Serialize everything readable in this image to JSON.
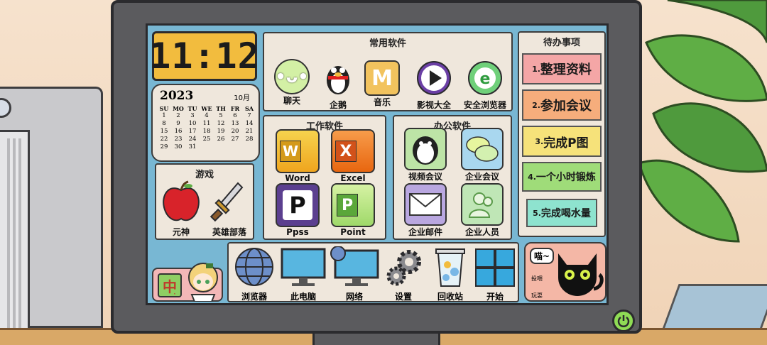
{
  "clock": {
    "time": "11:12"
  },
  "calendar": {
    "year": "2023",
    "month": "10月",
    "weekdays": [
      "SU",
      "MO",
      "TU",
      "WE",
      "TH",
      "FR",
      "SA"
    ],
    "weeks": [
      [
        "1",
        "2",
        "3",
        "4",
        "5",
        "6",
        "7"
      ],
      [
        "8",
        "9",
        "10",
        "11",
        "12",
        "13",
        "14"
      ],
      [
        "15",
        "16",
        "17",
        "18",
        "19",
        "20",
        "21"
      ],
      [
        "22",
        "23",
        "24",
        "25",
        "26",
        "27",
        "28"
      ],
      [
        "29",
        "30",
        "31",
        "",
        "",
        "",
        ""
      ]
    ]
  },
  "common_software": {
    "title": "常用软件",
    "apps": [
      {
        "label": "聊天",
        "icon": "chat-bubble-icon"
      },
      {
        "label": "企鹅",
        "icon": "penguin-icon"
      },
      {
        "label": "音乐",
        "icon": "music-m-icon"
      },
      {
        "label": "影视大全",
        "icon": "play-icon"
      },
      {
        "label": "安全浏览器",
        "icon": "browser-e-icon"
      }
    ]
  },
  "work_software": {
    "title": "工作软件",
    "apps": [
      {
        "label": "Word",
        "icon": "word-icon",
        "letter": "W"
      },
      {
        "label": "Excel",
        "icon": "excel-icon",
        "letter": "X"
      },
      {
        "label": "Ppss",
        "icon": "ppss-icon",
        "letter": "P"
      },
      {
        "label": "Point",
        "icon": "point-icon",
        "letter": "P"
      }
    ]
  },
  "office_software": {
    "title": "办公软件",
    "apps": [
      {
        "label": "视频会议",
        "icon": "penguin-video-icon"
      },
      {
        "label": "企业会议",
        "icon": "meeting-chat-icon"
      },
      {
        "label": "企业邮件",
        "icon": "mail-icon"
      },
      {
        "label": "企业人员",
        "icon": "people-icon"
      }
    ]
  },
  "games": {
    "title": "游戏",
    "apps": [
      {
        "label": "元神",
        "icon": "apple-icon"
      },
      {
        "label": "英雄部落",
        "icon": "sword-icon"
      }
    ]
  },
  "todo": {
    "title": "待办事项",
    "items": [
      {
        "num": "1.",
        "text": "整理资料",
        "color": "#f4a6a6"
      },
      {
        "num": "2.",
        "text": "参加会议",
        "color": "#f6ad7c"
      },
      {
        "num": "3.",
        "text": "完成P图",
        "color": "#f6e27a"
      },
      {
        "num": "4.",
        "text": "一个小时锻炼",
        "color": "#9fdc79"
      },
      {
        "num": "5.",
        "text": "完成喝水量",
        "color": "#8ee3cf"
      }
    ]
  },
  "taskbar": {
    "items": [
      {
        "label": "浏览器",
        "icon": "globe-icon"
      },
      {
        "label": "此电脑",
        "icon": "monitor-icon"
      },
      {
        "label": "网络",
        "icon": "network-icon"
      },
      {
        "label": "设置",
        "icon": "gear-icon"
      },
      {
        "label": "回收站",
        "icon": "recycle-bin-icon"
      },
      {
        "label": "开始",
        "icon": "windows-icon"
      }
    ]
  },
  "ime": {
    "lang": "中",
    "mode": "·"
  },
  "cat_widget": {
    "speech": "喵~",
    "feed": "投喂",
    "play": "玩耍"
  },
  "colors": {
    "screen": "#78b7d3",
    "panel": "#efe7dc",
    "clock": "#f2bc3e",
    "power": "#8fdc55"
  }
}
